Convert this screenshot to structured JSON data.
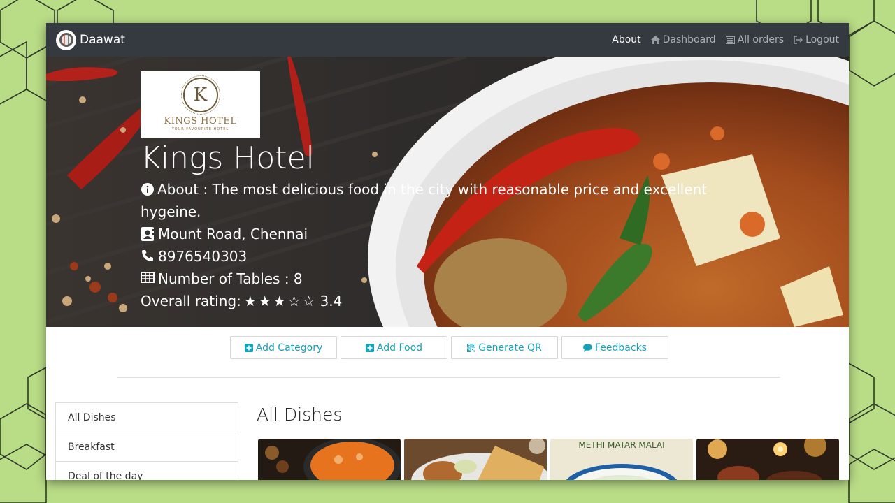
{
  "navbar": {
    "brand": "Daawat",
    "links": [
      {
        "label": "About",
        "icon": "",
        "active": true
      },
      {
        "label": "Dashboard",
        "icon": "home-icon",
        "active": false
      },
      {
        "label": "All orders",
        "icon": "list-icon",
        "active": false
      },
      {
        "label": "Logout",
        "icon": "logout-icon",
        "active": false
      }
    ]
  },
  "hotel": {
    "logo_text": "KINGS HOTEL",
    "logo_letter": "K",
    "logo_tagline": "YOUR FAVOURITE HOTEL",
    "name": "Kings Hotel",
    "about": "About : The most delicious food in the city with reasonable price and excellent hygeine.",
    "address": "Mount Road, Chennai",
    "phone": "8976540303",
    "tables": "Number of Tables : 8",
    "rating_label": "Overall rating:",
    "rating_value": "3.4",
    "rating_stars_filled": 3,
    "rating_stars_total": 5
  },
  "actions": [
    {
      "label": "Add Category",
      "icon": "plus-square-icon"
    },
    {
      "label": "Add Food",
      "icon": "plus-square-icon"
    },
    {
      "label": "Generate QR",
      "icon": "qrcode-icon"
    },
    {
      "label": "Feedbacks",
      "icon": "comment-icon"
    }
  ],
  "sidebar": {
    "items": [
      {
        "label": "All Dishes"
      },
      {
        "label": "Breakfast"
      },
      {
        "label": "Deal of the day"
      }
    ]
  },
  "main": {
    "title": "All Dishes",
    "dish_caption_3": "METHI MATAR MALAI"
  },
  "colors": {
    "page_bg": "#b9dc86",
    "navbar": "#343a40",
    "accent": "#17a2b8"
  }
}
